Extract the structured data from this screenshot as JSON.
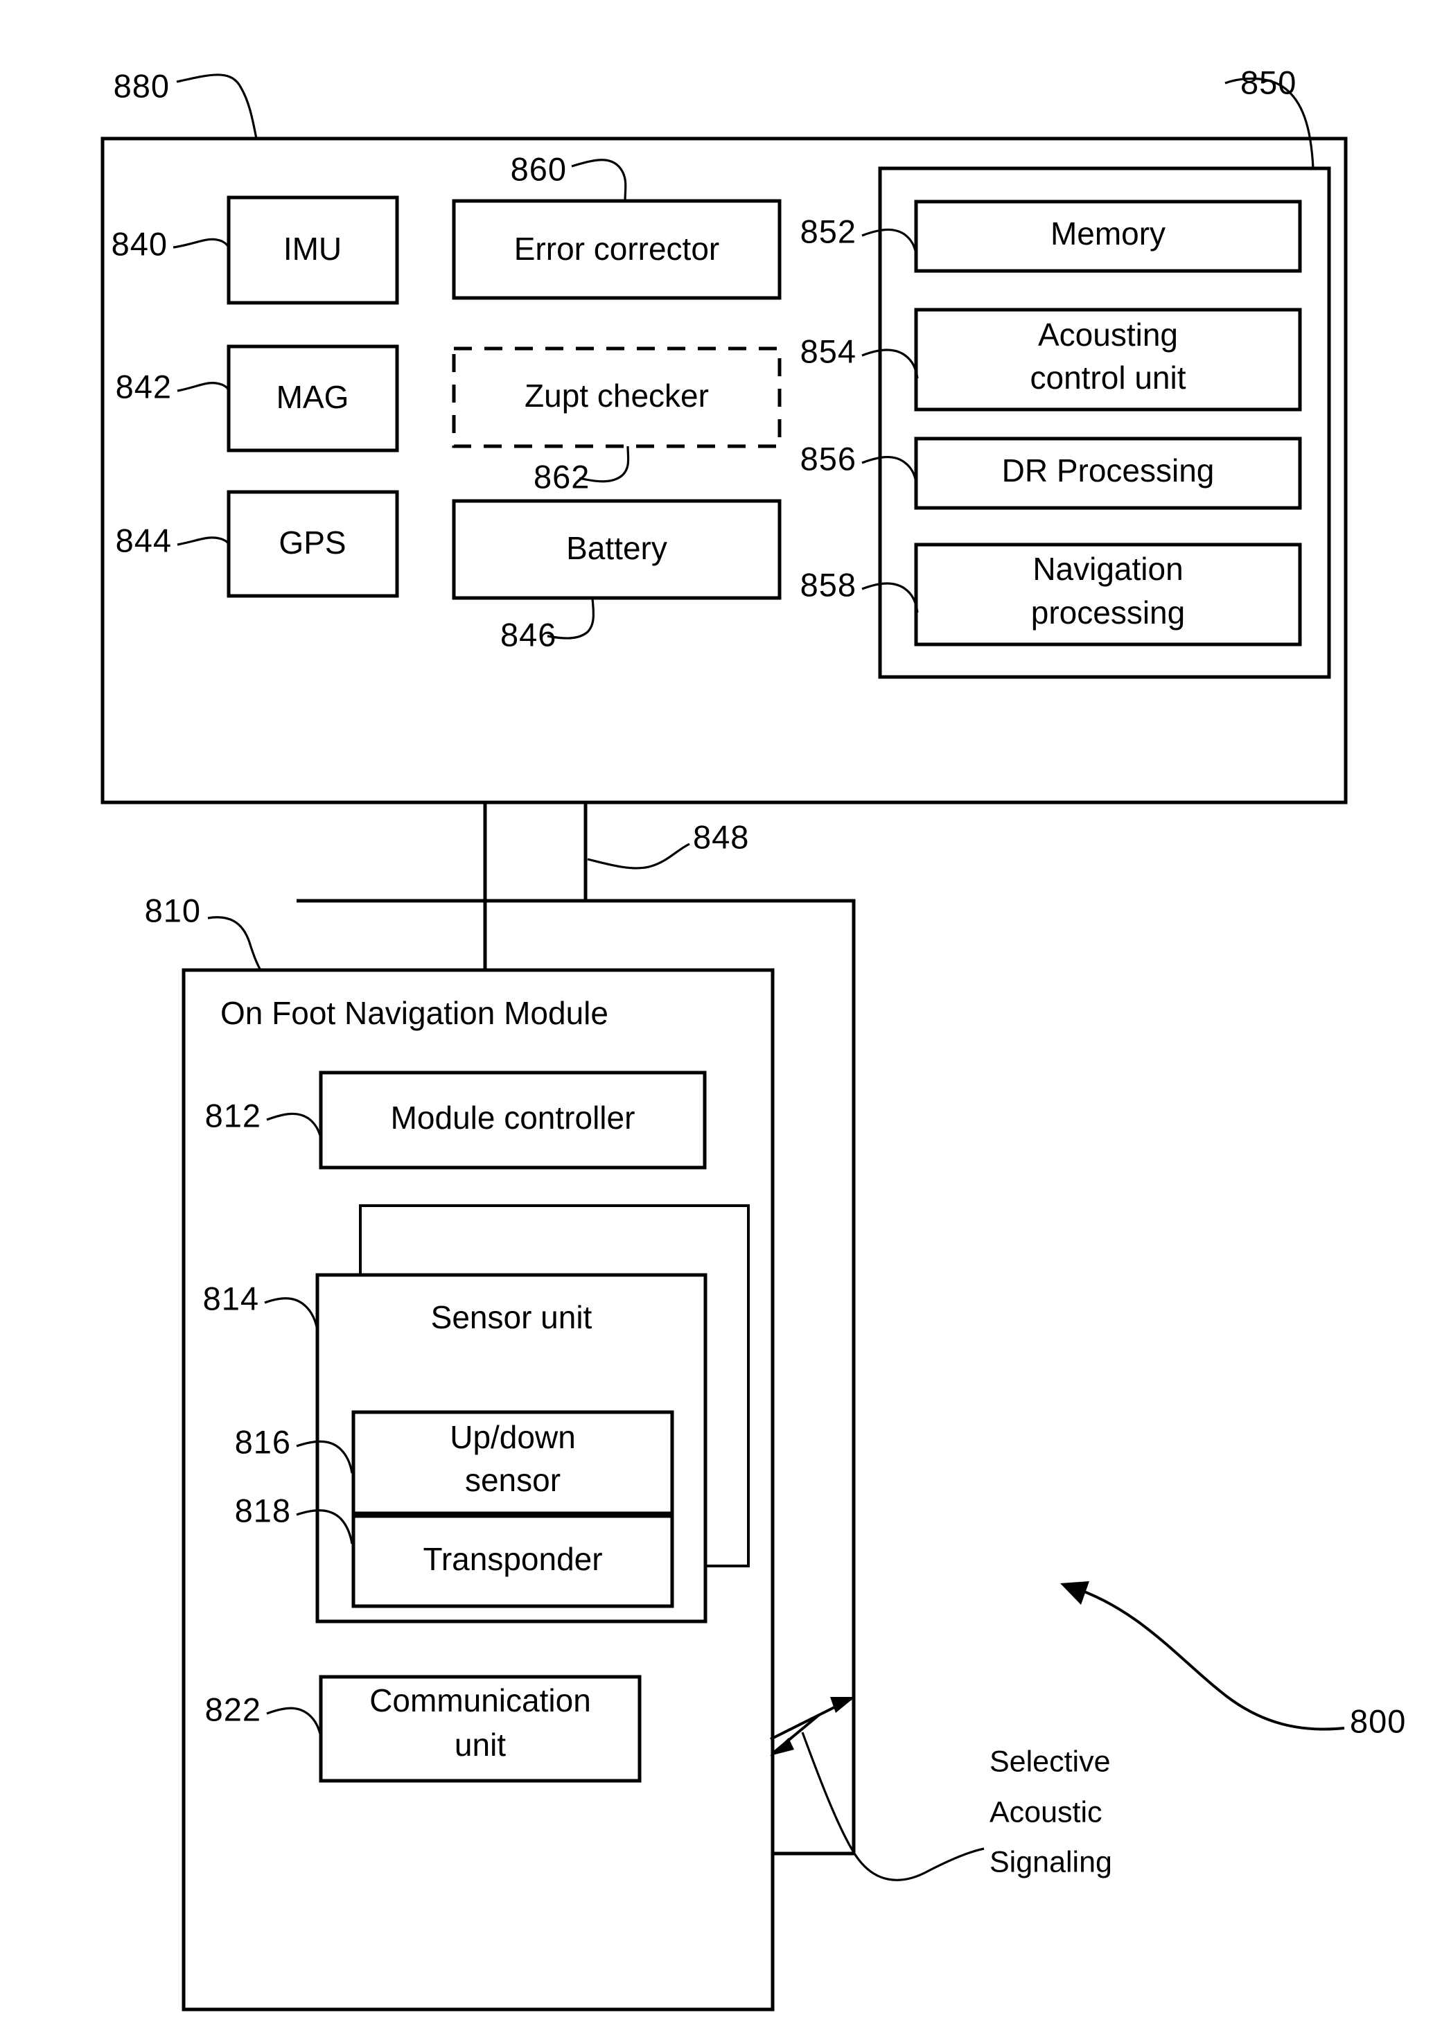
{
  "figure": {
    "type": "patent-block-diagram",
    "overall_ref": "800",
    "outer_system": {
      "ref": "880",
      "components": [
        {
          "ref": "840",
          "label": "IMU"
        },
        {
          "ref": "842",
          "label": "MAG"
        },
        {
          "ref": "844",
          "label": "GPS"
        },
        {
          "ref": "860",
          "label": "Error corrector"
        },
        {
          "ref": "862",
          "label": "Zupt checker",
          "style": "dashed"
        },
        {
          "ref": "846",
          "label": "Battery"
        }
      ],
      "processor_group": {
        "ref": "850",
        "items": [
          {
            "ref": "852",
            "label": "Memory"
          },
          {
            "ref": "854",
            "label": "Acousting control unit"
          },
          {
            "ref": "856",
            "label": "DR Processing"
          },
          {
            "ref": "858",
            "label": "Navigation processing"
          }
        ]
      }
    },
    "link": {
      "ref": "848"
    },
    "foot_module": {
      "ref": "810",
      "title": "On Foot Navigation Module",
      "components": [
        {
          "ref": "812",
          "label": "Module controller"
        },
        {
          "ref": "814",
          "label": "Sensor unit",
          "stacked": true
        },
        {
          "ref": "816",
          "label": "Up/down sensor"
        },
        {
          "ref": "818",
          "label": "Transponder"
        },
        {
          "ref": "822",
          "label": "Communication unit"
        }
      ]
    },
    "annotations": [
      {
        "name": "selective-acoustic-signaling",
        "lines": [
          "Selective",
          "Acoustic",
          "Signaling"
        ]
      }
    ],
    "labels": {
      "acousting_line1": "Acousting",
      "acousting_line2": "control unit",
      "navigation_line1": "Navigation",
      "navigation_line2": "processing",
      "updown_line1": "Up/down",
      "updown_line2": "sensor",
      "communication_line1": "Communication",
      "communication_line2": "unit",
      "annot_line1": "Selective",
      "annot_line2": "Acoustic",
      "annot_line3": "Signaling"
    },
    "refs": {
      "r800": "800",
      "r810": "810",
      "r812": "812",
      "r814": "814",
      "r816": "816",
      "r818": "818",
      "r822": "822",
      "r840": "840",
      "r842": "842",
      "r844": "844",
      "r846": "846",
      "r848": "848",
      "r850": "850",
      "r852": "852",
      "r854": "854",
      "r856": "856",
      "r858": "858",
      "r860": "860",
      "r862": "862",
      "r880": "880"
    },
    "colors": {
      "stroke": "#000000",
      "background": "#ffffff"
    }
  }
}
